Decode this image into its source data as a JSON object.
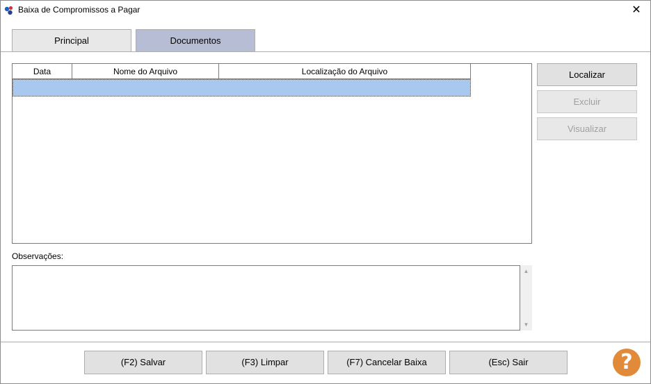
{
  "window": {
    "title": "Baixa de Compromissos a Pagar",
    "close_glyph": "✕",
    "icon": "app-logo-icon"
  },
  "tabs": [
    {
      "label": "Principal",
      "active": false
    },
    {
      "label": "Documentos",
      "active": true
    }
  ],
  "grid": {
    "columns": [
      "Data",
      "Nome do Arquivo",
      "Localização do Arquivo"
    ],
    "rows": [
      {
        "data": "",
        "nome": "",
        "local": "",
        "selected": true
      }
    ]
  },
  "side_buttons": {
    "localizar": "Localizar",
    "excluir": "Excluir",
    "visualizar": "Visualizar"
  },
  "observacoes": {
    "label": "Observações:",
    "value": ""
  },
  "footer_buttons": {
    "salvar": "(F2) Salvar",
    "limpar": "(F3) Limpar",
    "cancelar": "(F7) Cancelar Baixa",
    "sair": "(Esc) Sair"
  },
  "help": {
    "glyph": "?",
    "icon": "help-icon"
  },
  "colors": {
    "active_tab": "#b8bdd6",
    "selected_row": "#a8c8f0",
    "help_orange": "#e08a3a"
  }
}
